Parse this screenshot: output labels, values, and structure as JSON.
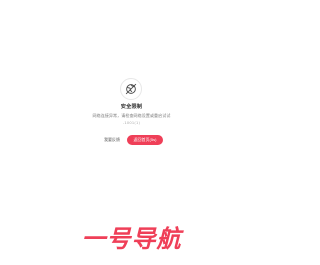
{
  "error": {
    "icon": "globe-off-icon",
    "title": "安全限制",
    "description": "网络连接异常，请检查网络设置或重启试试",
    "code": "-1001(1)"
  },
  "actions": {
    "secondary_label": "我要反馈",
    "primary_label": "返回首页(5s)"
  },
  "brand": {
    "logo_text": "一号导航"
  },
  "colors": {
    "accent": "#ef3f58",
    "text": "#333333",
    "muted": "#7a7a7a"
  }
}
